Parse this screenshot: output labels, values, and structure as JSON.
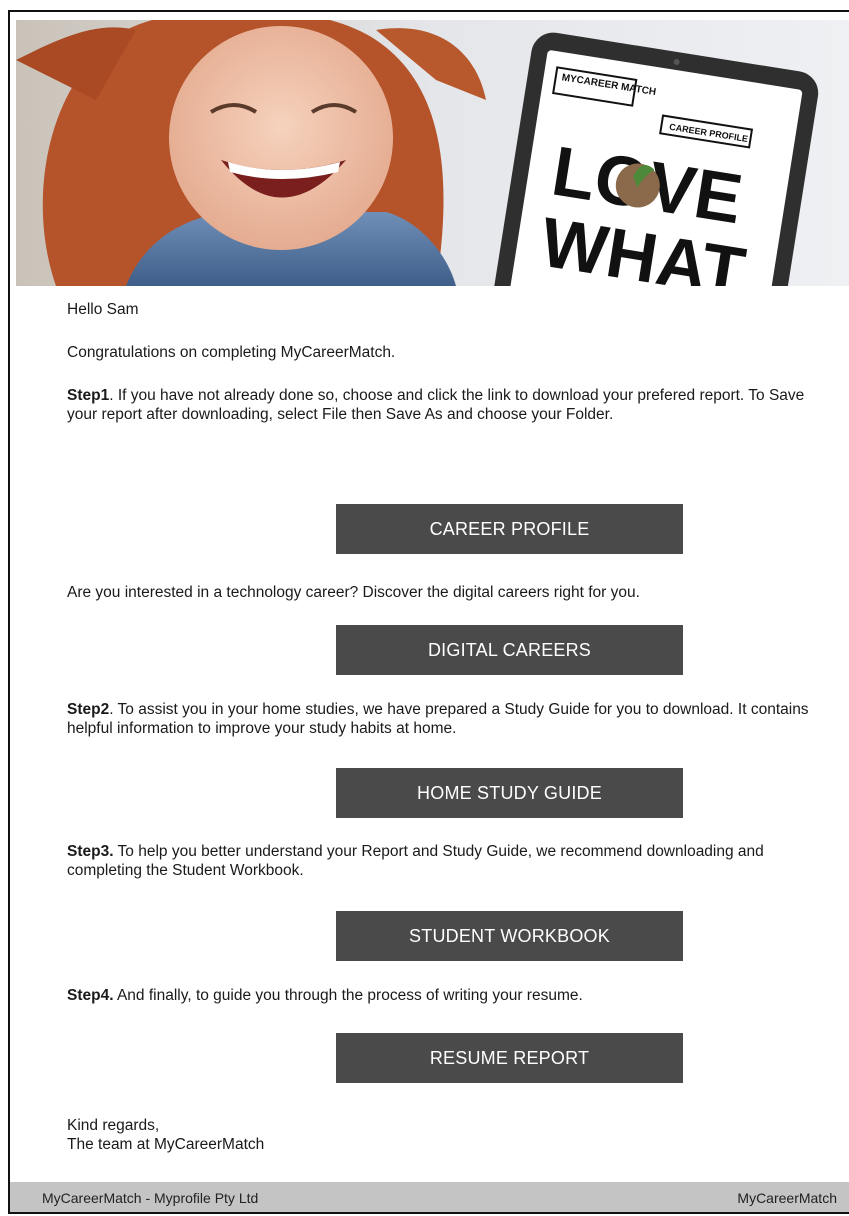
{
  "hero": {
    "tablet_logo": "MYCAREER MATCH",
    "tablet_badge": "CAREER PROFILE",
    "tablet_headline_1": "LOVE",
    "tablet_headline_2": "WHAT"
  },
  "email": {
    "greeting": "Hello Sam",
    "congrats": "Congratulations on completing MyCareerMatch.",
    "step1_label": "Step1",
    "step1_text": ". If you have not already done so, choose and click the link to download your prefered report. To Save your report after downloading, select File then Save As and choose your Folder.",
    "career_profile_button": "CAREER PROFILE",
    "tech_text": "Are you interested in a technology career? Discover the digital careers right for you.",
    "digital_careers_button": "DIGITAL CAREERS",
    "step2_label": "Step2",
    "step2_text": ". To assist you in your home studies, we have prepared a Study Guide for you to download. It contains helpful information to improve your study habits at home.",
    "home_study_button": "HOME STUDY GUIDE",
    "step3_label": "Step3.",
    "step3_text": " To help you better understand your Report and Study Guide, we recommend downloading and completing the Student Workbook.",
    "student_workbook_button": "STUDENT WORKBOOK",
    "step4_label": "Step4.",
    "step4_text": " And finally, to guide you through the process of writing your resume.",
    "resume_report_button": "RESUME REPORT",
    "signoff_1": "Kind regards,",
    "signoff_2": "The team at MyCareerMatch"
  },
  "footer": {
    "left": "MyCareerMatch - Myprofile Pty Ltd",
    "right": "MyCareerMatch"
  },
  "colors": {
    "button_bg": "#4a4a4a",
    "button_text": "#ffffff",
    "footer_bg": "#c4c4c4"
  }
}
